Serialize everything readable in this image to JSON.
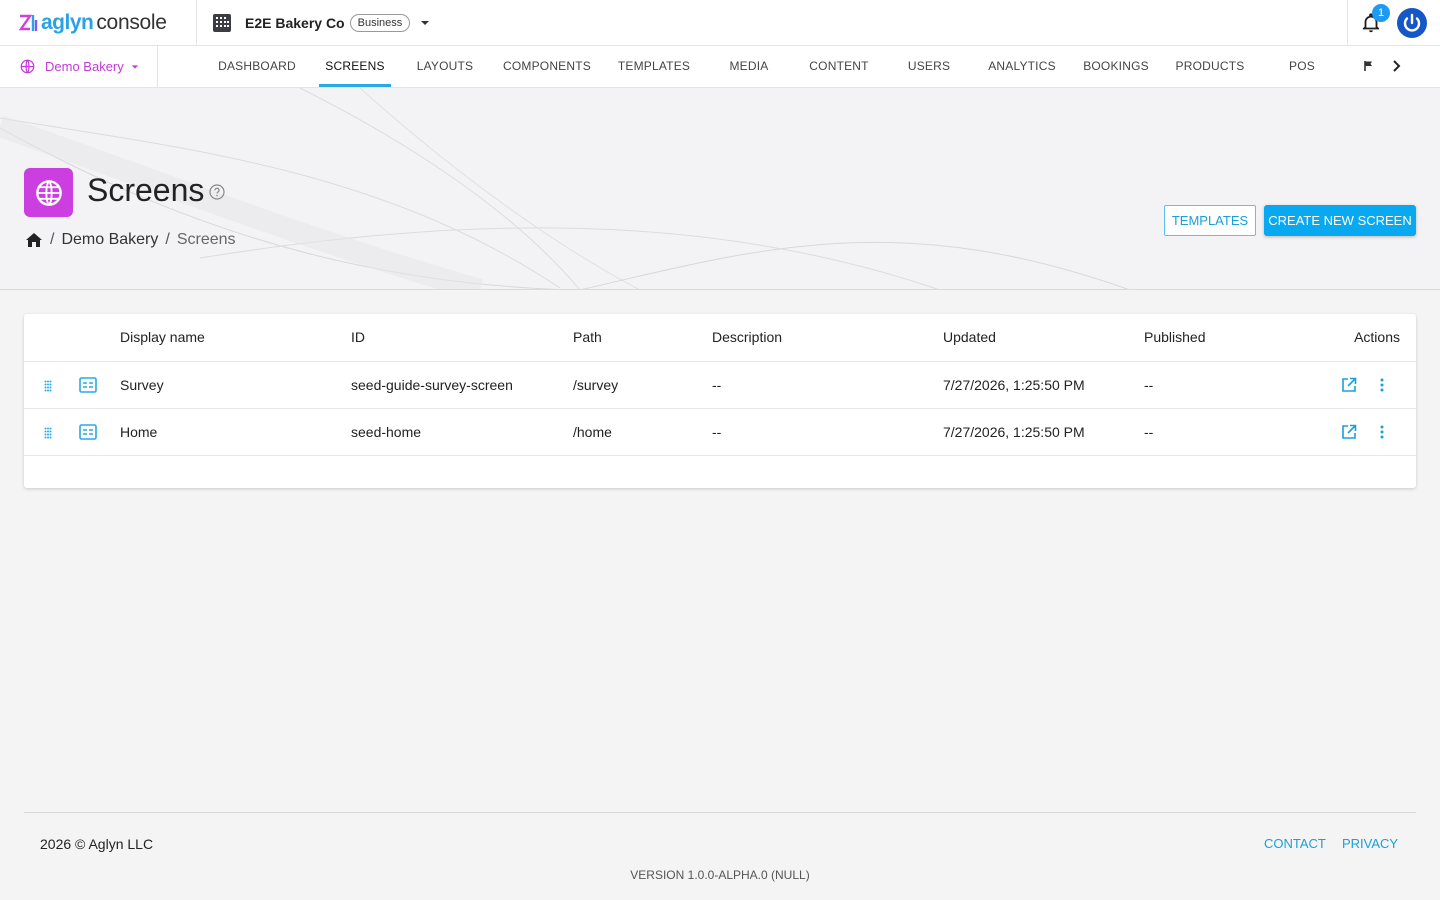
{
  "brand": {
    "name": "aglyn",
    "suffix": "console"
  },
  "org": {
    "name": "E2E Bakery Co",
    "plan": "Business"
  },
  "notifications": {
    "count": "1"
  },
  "site": {
    "name": "Demo Bakery"
  },
  "nav": {
    "tabs": [
      "DASHBOARD",
      "SCREENS",
      "LAYOUTS",
      "COMPONENTS",
      "TEMPLATES",
      "MEDIA",
      "CONTENT",
      "USERS",
      "ANALYTICS",
      "BOOKINGS",
      "PRODUCTS",
      "POS"
    ],
    "active": "SCREENS"
  },
  "page": {
    "title": "Screens",
    "breadcrumb": [
      "Demo Bakery",
      "Screens"
    ],
    "templates_label": "TEMPLATES",
    "create_label": "CREATE NEW SCREEN"
  },
  "table": {
    "columns": [
      "Display name",
      "ID",
      "Path",
      "Description",
      "Updated",
      "Published",
      "Actions"
    ],
    "rows": [
      {
        "name": "Survey",
        "id": "seed-guide-survey-screen",
        "path": "/survey",
        "description": "--",
        "updated": "7/27/2026, 1:25:50 PM",
        "published": "--"
      },
      {
        "name": "Home",
        "id": "seed-home",
        "path": "/home",
        "description": "--",
        "updated": "7/27/2026, 1:25:50 PM",
        "published": "--"
      }
    ]
  },
  "footer": {
    "copyright": "2026 © Aglyn LLC",
    "contact": "CONTACT",
    "privacy": "PRIVACY",
    "version": "VERSION 1.0.0-ALPHA.0 (NULL)"
  },
  "colors": {
    "accent": "#08a9f0",
    "brand_magenta": "#cb3ee0",
    "link": "#1aa0d8"
  }
}
